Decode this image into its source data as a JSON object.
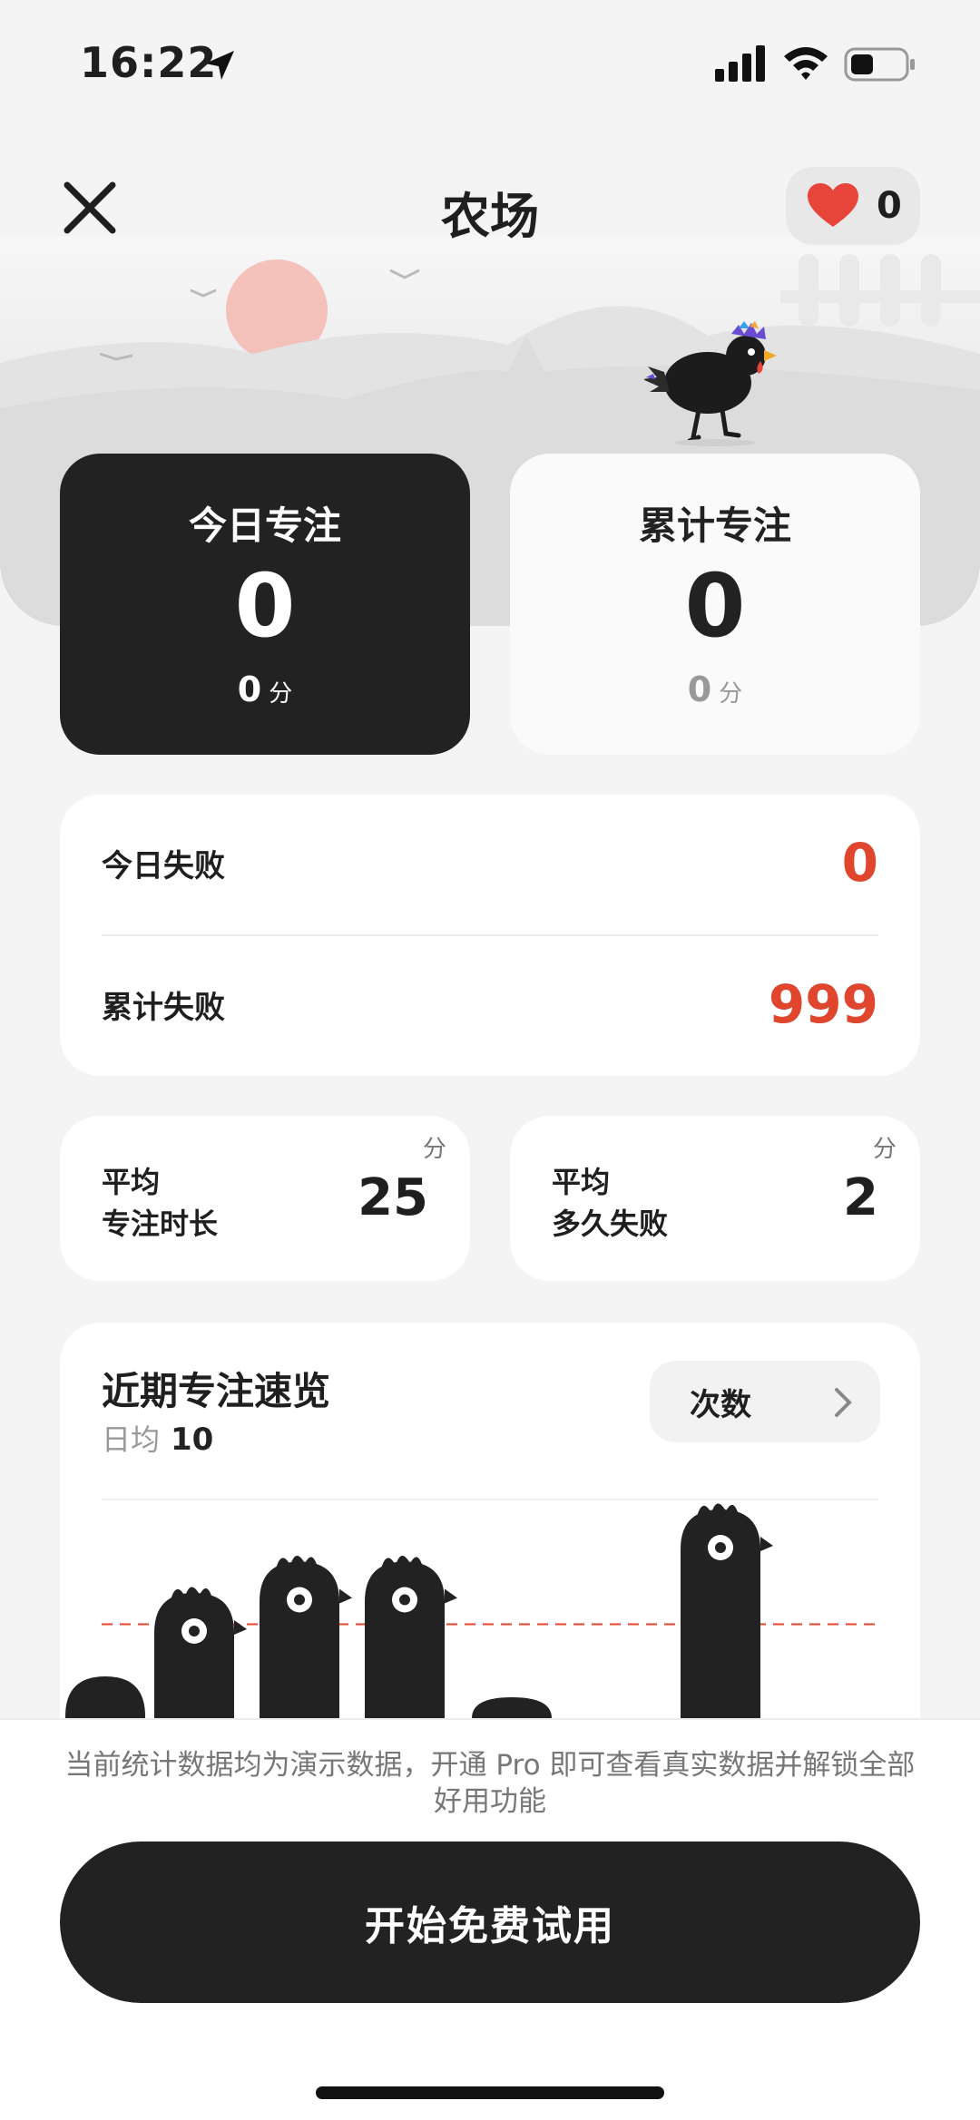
{
  "status_bar": {
    "time": "16:22"
  },
  "header": {
    "title": "农场",
    "hearts": "0"
  },
  "today_focus": {
    "label": "今日专注",
    "count": "0",
    "minutes": "0",
    "unit": "分"
  },
  "total_focus": {
    "label": "累计专注",
    "count": "0",
    "minutes": "0",
    "unit": "分"
  },
  "failures": {
    "today_label": "今日失败",
    "today_value": "0",
    "total_label": "累计失败",
    "total_value": "999"
  },
  "averages": [
    {
      "label_line1": "平均",
      "label_line2": "专注时长",
      "value": "25",
      "unit": "分"
    },
    {
      "label_line1": "平均",
      "label_line2": "多久失败",
      "value": "2",
      "unit": "分"
    }
  ],
  "recent": {
    "title": "近期专注速览",
    "daily_avg_label": "日均",
    "daily_avg_value": "10",
    "metric_button": "次数"
  },
  "chart_data": {
    "type": "bar",
    "categories": [],
    "values": [
      0.2,
      0.6,
      0.75,
      0.75,
      0.1,
      0,
      1.0
    ],
    "avg_line": 0.45,
    "grid": false,
    "legend": "none"
  },
  "colors": {
    "accent_red": "#e0452e",
    "dark": "#222222",
    "background": "#f4f4f4"
  },
  "footer": {
    "notice": "当前统计数据均为演示数据，开通 Pro 即可查看真实数据并解锁全部好用功能",
    "cta": "开始免费试用"
  }
}
